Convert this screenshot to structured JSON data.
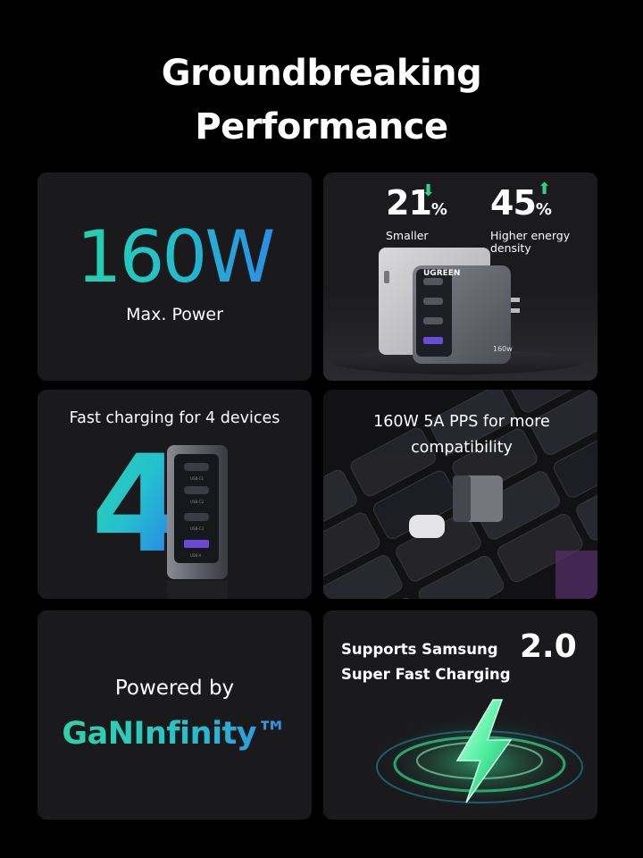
{
  "headline": {
    "line1": "Groundbreaking",
    "line2": "Performance"
  },
  "power_card": {
    "value": "160W",
    "label": "Max. Power"
  },
  "size_card": {
    "stat1": {
      "number": "21",
      "unit": "%",
      "label": "Smaller",
      "trend": "down"
    },
    "stat2": {
      "number": "45",
      "unit": "%",
      "label_line1": "Higher energy",
      "label_line2": "density",
      "trend": "up"
    },
    "brand": "UGREEN",
    "product_badge": "160w"
  },
  "devices_card": {
    "title": "Fast charging for 4 devices",
    "count": "4",
    "ports": [
      "USB-C1",
      "USB-C2",
      "USB-C3",
      "USB-A"
    ]
  },
  "pps_card": {
    "line1": "160W 5A PPS for more",
    "line2": "compatibility"
  },
  "gan_card": {
    "line1": "Powered by",
    "line2": "GaNInfinity™"
  },
  "samsung_card": {
    "line1": "Supports Samsung",
    "line2": "Super Fast Charging",
    "version": "2.0"
  },
  "colors": {
    "accent_green": "#27d6a0",
    "accent_blue": "#2a7ef0",
    "card_bg": "#1a1a1c",
    "page_bg": "#000000"
  }
}
